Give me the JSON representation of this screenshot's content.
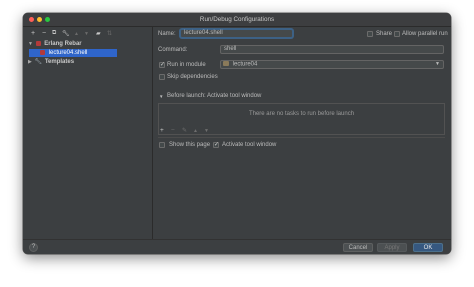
{
  "window": {
    "title": "Run/Debug Configurations",
    "traffic_lights": [
      "#ff5f57",
      "#febc2e",
      "#28c840"
    ]
  },
  "sidebar": {
    "toolbar_icons": [
      "add-icon",
      "remove-icon",
      "copy-icon",
      "wrench-icon",
      "move-up-icon",
      "move-down-icon",
      "folder-icon",
      "sort-icon"
    ],
    "tree": {
      "group_label": "Erlang Rebar",
      "group_icon": "erlang-icon",
      "item_label": "lecture04.shell",
      "templates_label": "Templates"
    }
  },
  "form": {
    "name_label": "Name:",
    "name_value": "lecture04.shell",
    "share_label": "Share",
    "allow_parallel_label": "Allow parallel run",
    "command_label": "Command:",
    "command_value": "shell",
    "run_in_module_label": "Run in module",
    "module_value": "lecture04",
    "skip_deps_label": "Skip dependencies"
  },
  "before_launch": {
    "header": "Before launch: Activate tool window",
    "empty_text": "There are no tasks to run before launch",
    "toolbar_icons": [
      "add-icon",
      "remove-icon",
      "edit-icon",
      "move-up-icon",
      "move-down-icon"
    ]
  },
  "options": {
    "show_page_label": "Show this page",
    "activate_tool_window_label": "Activate tool window"
  },
  "footer": {
    "help_label": "?",
    "cancel_label": "Cancel",
    "apply_label": "Apply",
    "ok_label": "OK"
  },
  "colors": {
    "accent": "#2f65ca",
    "background": "#3c3f41"
  }
}
